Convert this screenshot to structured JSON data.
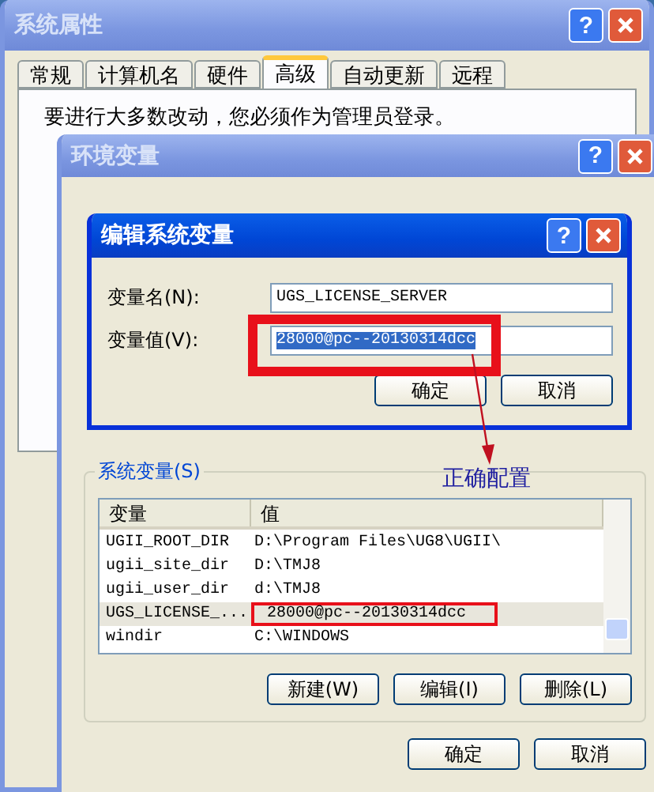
{
  "system_properties": {
    "title": "系统属性",
    "help": "?",
    "tabs": [
      {
        "label": "常规",
        "selected": false
      },
      {
        "label": "计算机名",
        "selected": false
      },
      {
        "label": "硬件",
        "selected": false
      },
      {
        "label": "高级",
        "selected": true
      },
      {
        "label": "自动更新",
        "selected": false
      },
      {
        "label": "远程",
        "selected": false
      }
    ],
    "notice": "要进行大多数改动，您必须作为管理员登录。"
  },
  "environment_variables": {
    "title": "环境变量",
    "help": "?",
    "system_variables": {
      "label": "系统变量(S)",
      "columns": [
        "变量",
        "值"
      ],
      "rows": [
        {
          "name": "UGII_ROOT_DIR",
          "value": "D:\\Program Files\\UG8\\UGII\\",
          "selected": false
        },
        {
          "name": "ugii_site_dir",
          "value": "D:\\TMJ8",
          "selected": false
        },
        {
          "name": "ugii_user_dir",
          "value": "d:\\TMJ8",
          "selected": false
        },
        {
          "name": "UGS_LICENSE_...",
          "value": "28000@pc--20130314dcc",
          "selected": true
        },
        {
          "name": "windir",
          "value": "C:\\WINDOWS",
          "selected": false
        }
      ],
      "buttons": [
        "新建(W)",
        "编辑(I)",
        "删除(L)"
      ]
    },
    "buttons": [
      "确定",
      "取消"
    ]
  },
  "edit_system_variable": {
    "title": "编辑系统变量",
    "help": "?",
    "fields": [
      {
        "label": "变量名(N):",
        "value": "UGS_LICENSE_SERVER",
        "selected": false
      },
      {
        "label": "变量值(V):",
        "value": "28000@pc--20130314dcc",
        "selected": true
      }
    ],
    "buttons": [
      "确定",
      "取消"
    ]
  },
  "annotation": {
    "text": "正确配置"
  }
}
